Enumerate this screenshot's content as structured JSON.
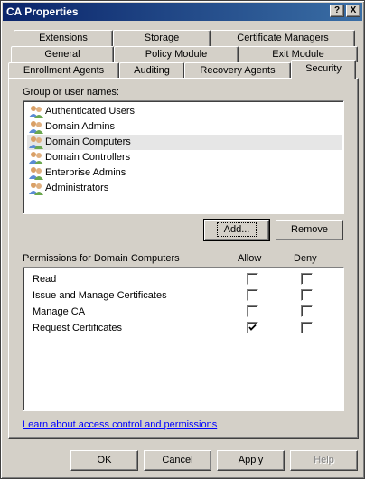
{
  "window": {
    "title": "CA Properties",
    "help_button": "?",
    "close_button": "X"
  },
  "tabs": {
    "row1": [
      {
        "label": "Extensions"
      },
      {
        "label": "Storage"
      },
      {
        "label": "Certificate Managers"
      }
    ],
    "row2": [
      {
        "label": "General"
      },
      {
        "label": "Policy Module"
      },
      {
        "label": "Exit Module"
      }
    ],
    "row3": [
      {
        "label": "Enrollment Agents"
      },
      {
        "label": "Auditing"
      },
      {
        "label": "Recovery Agents"
      },
      {
        "label": "Security",
        "active": true
      }
    ]
  },
  "security": {
    "group_label": "Group or user names:",
    "users": [
      {
        "name": "Authenticated Users"
      },
      {
        "name": "Domain Admins"
      },
      {
        "name": "Domain Computers",
        "selected": true
      },
      {
        "name": "Domain Controllers"
      },
      {
        "name": "Enterprise Admins"
      },
      {
        "name": "Administrators"
      }
    ],
    "add_button": "Add...",
    "remove_button": "Remove",
    "permissions_label": "Permissions for Domain Computers",
    "allow_header": "Allow",
    "deny_header": "Deny",
    "permissions": [
      {
        "name": "Read",
        "allow": false,
        "deny": false
      },
      {
        "name": "Issue and Manage Certificates",
        "allow": false,
        "deny": false
      },
      {
        "name": "Manage CA",
        "allow": false,
        "deny": false
      },
      {
        "name": "Request Certificates",
        "allow": true,
        "deny": false
      }
    ],
    "learn_link": "Learn about access control and permissions"
  },
  "footer": {
    "ok": "OK",
    "cancel": "Cancel",
    "apply": "Apply",
    "help": "Help"
  }
}
